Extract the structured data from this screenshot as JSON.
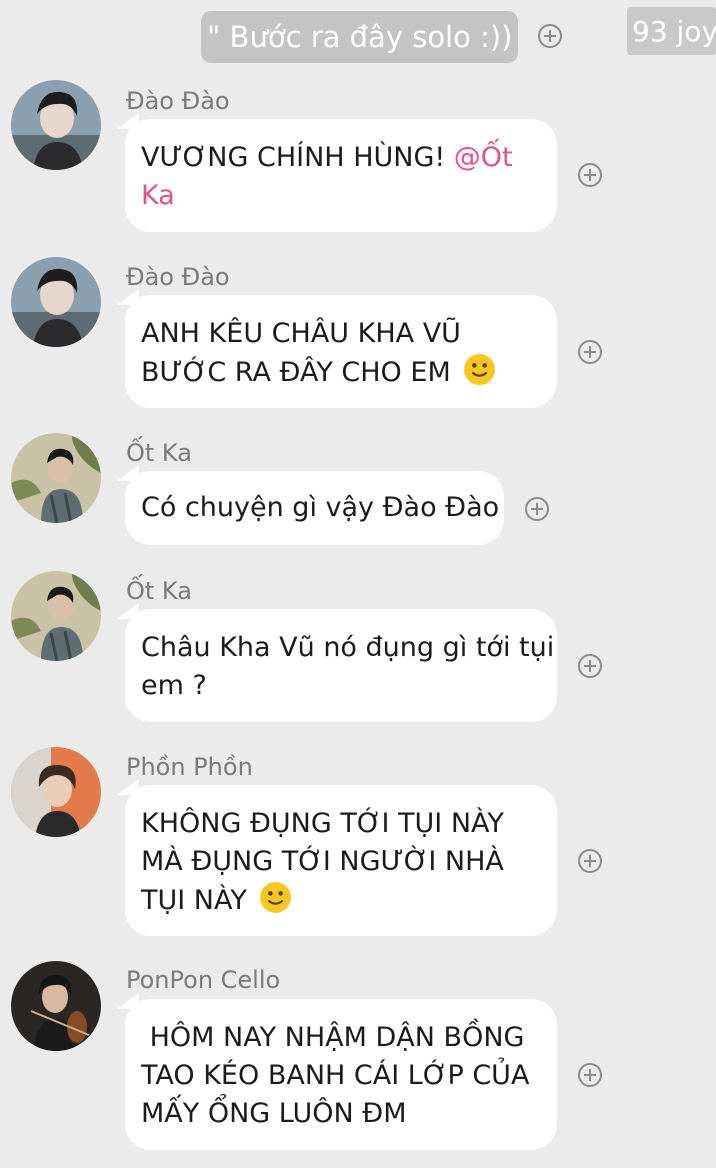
{
  "top": {
    "quote_text": "\" Bước ra đây solo :)) \"",
    "watermark": "93 joy"
  },
  "messages": [
    {
      "sender": "Đào Đào",
      "lines": [
        "VƯƠNG CHÍNH HÙNG! "
      ],
      "mention_line1": "@Ốt",
      "mention_line2": "Ka"
    },
    {
      "sender": "Đào Đào",
      "lines": [
        "ANH KÊU CHÂU KHA VŨ",
        "BƯỚC RA ĐÂY CHO EM "
      ]
    },
    {
      "sender": "Ốt Ka",
      "lines": [
        "Có chuyện gì vậy Đào Đào"
      ]
    },
    {
      "sender": "Ốt Ka",
      "lines": [
        "Châu Kha Vũ nó đụng gì tới tụi",
        "em ?"
      ]
    },
    {
      "sender": "Phồn Phồn",
      "lines": [
        "KHÔNG ĐỤNG TỚI TỤI NÀY",
        "MÀ ĐỤNG TỚI NGƯỜI NHÀ",
        "TỤI NÀY "
      ]
    },
    {
      "sender": "PonPon Cello",
      "lines": [
        " HÔM NAY NHẬM DẬN BỒNG",
        "TAO KÉO BANH CÁI LỚP CỦA",
        "MẤY ỔNG LUÔN ĐM"
      ]
    }
  ],
  "colors": {
    "background": "#ebebeb",
    "bubble": "#ffffff",
    "mention": "#e2508f",
    "sender_name": "#7b7b7b"
  }
}
